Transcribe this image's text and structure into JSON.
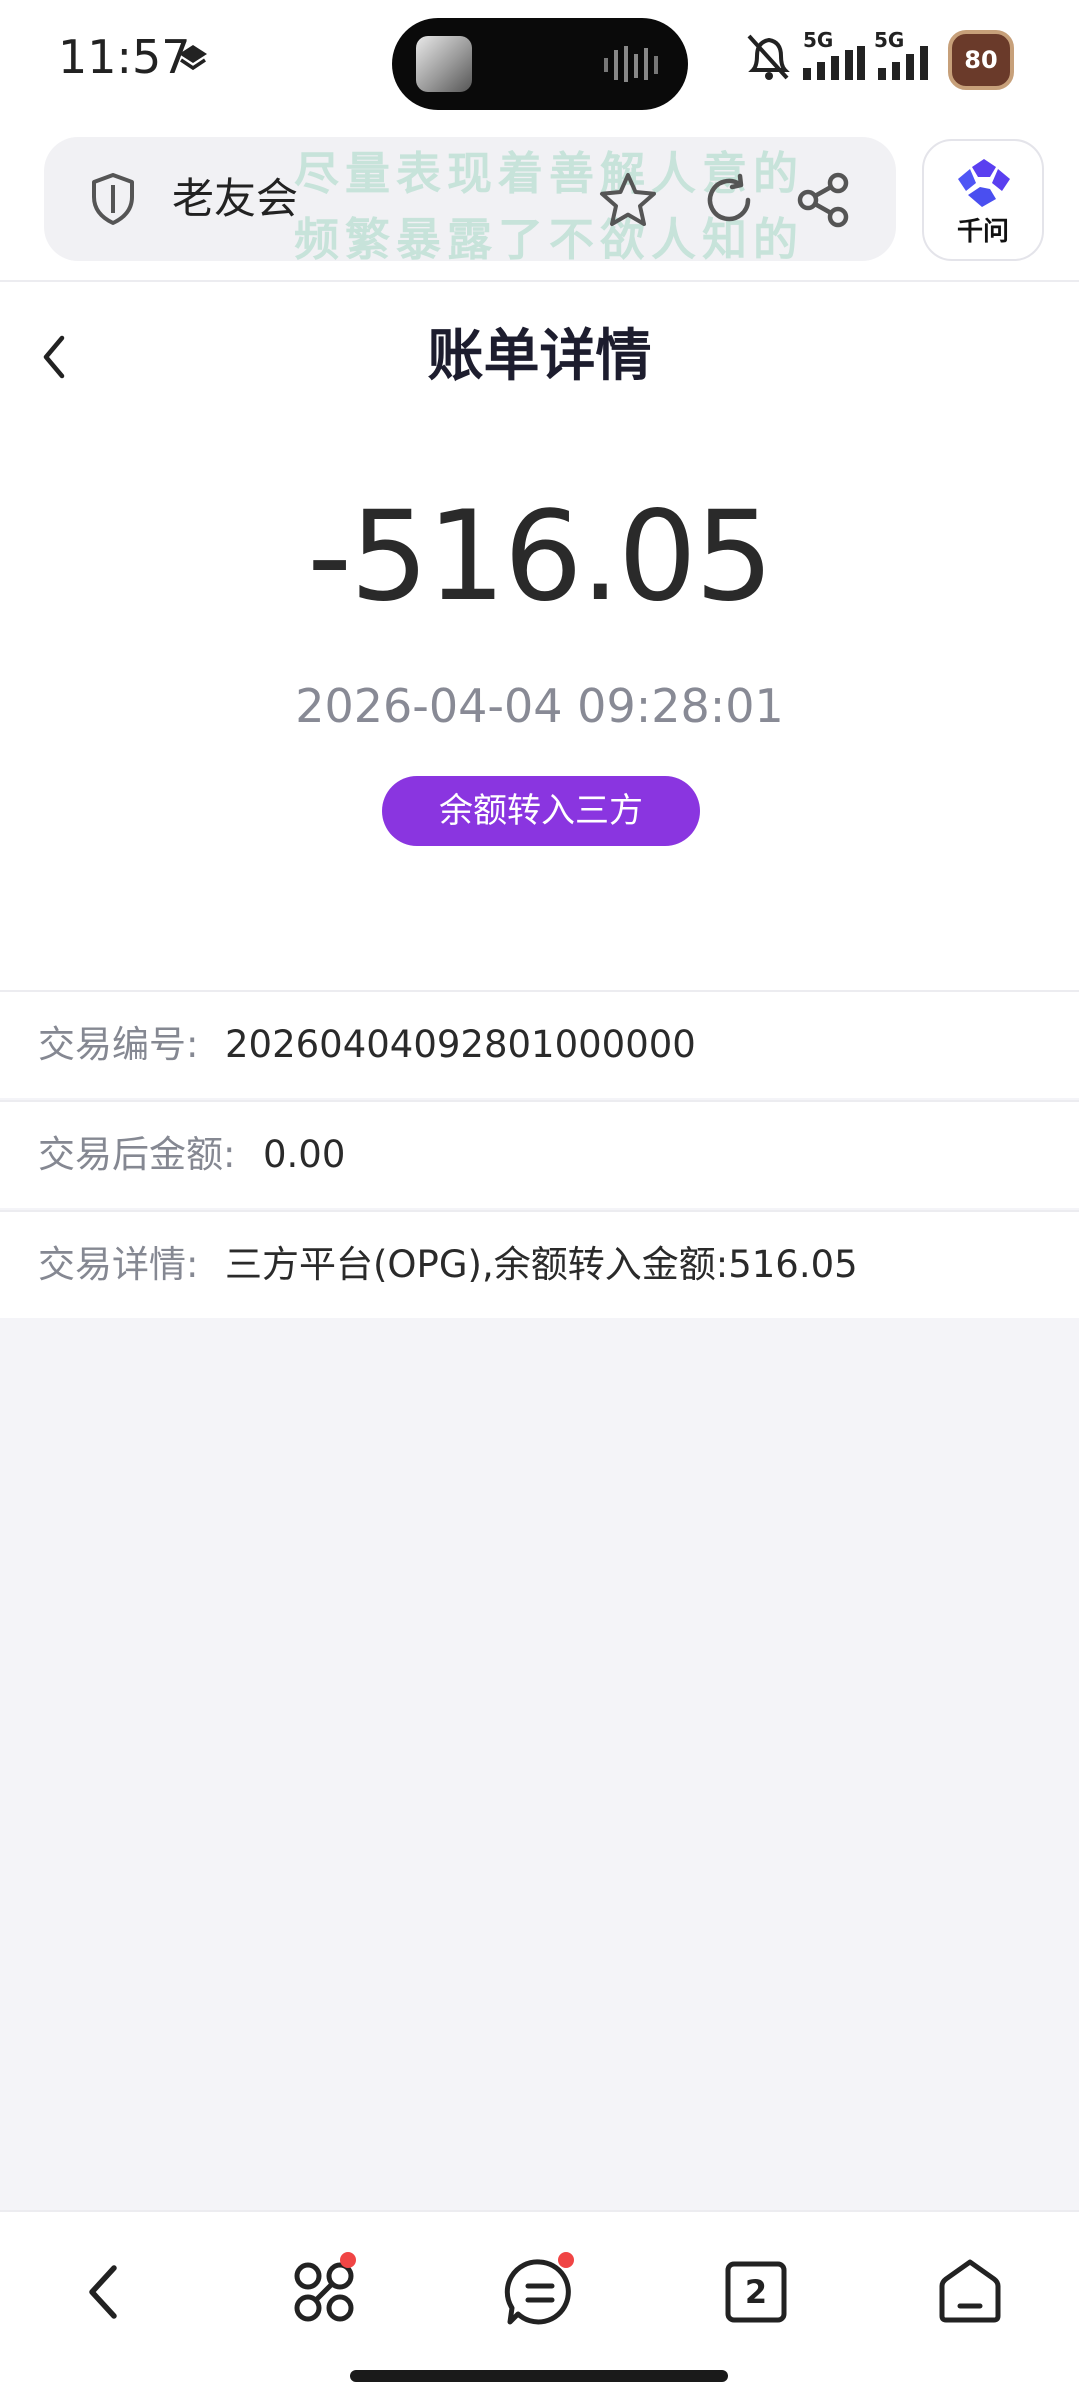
{
  "status_bar": {
    "time": "11:57",
    "signal_1_label": "5G",
    "signal_2_label": "5G",
    "battery": "80"
  },
  "browser": {
    "site_name": "老友会",
    "overlay_line_1": "尽量表现着善解人意的",
    "overlay_line_2": "频繁暴露了不欲人知的",
    "assistant_label": "千问"
  },
  "header": {
    "title": "账单详情"
  },
  "bill": {
    "amount": "-516.05",
    "datetime": "2026-04-04 09:28:01",
    "type_badge": "余额转入三方",
    "rows": [
      {
        "label": "交易编号:",
        "value": "20260404092801000000"
      },
      {
        "label": "交易后金额:",
        "value": "0.00"
      },
      {
        "label": "交易详情:",
        "value": "三方平台(OPG),余额转入金额:516.05"
      }
    ]
  },
  "bottom_nav": {
    "tab_count": "2"
  },
  "colors": {
    "badge": "#8a35e0",
    "page_background": "#f4f4f8"
  }
}
